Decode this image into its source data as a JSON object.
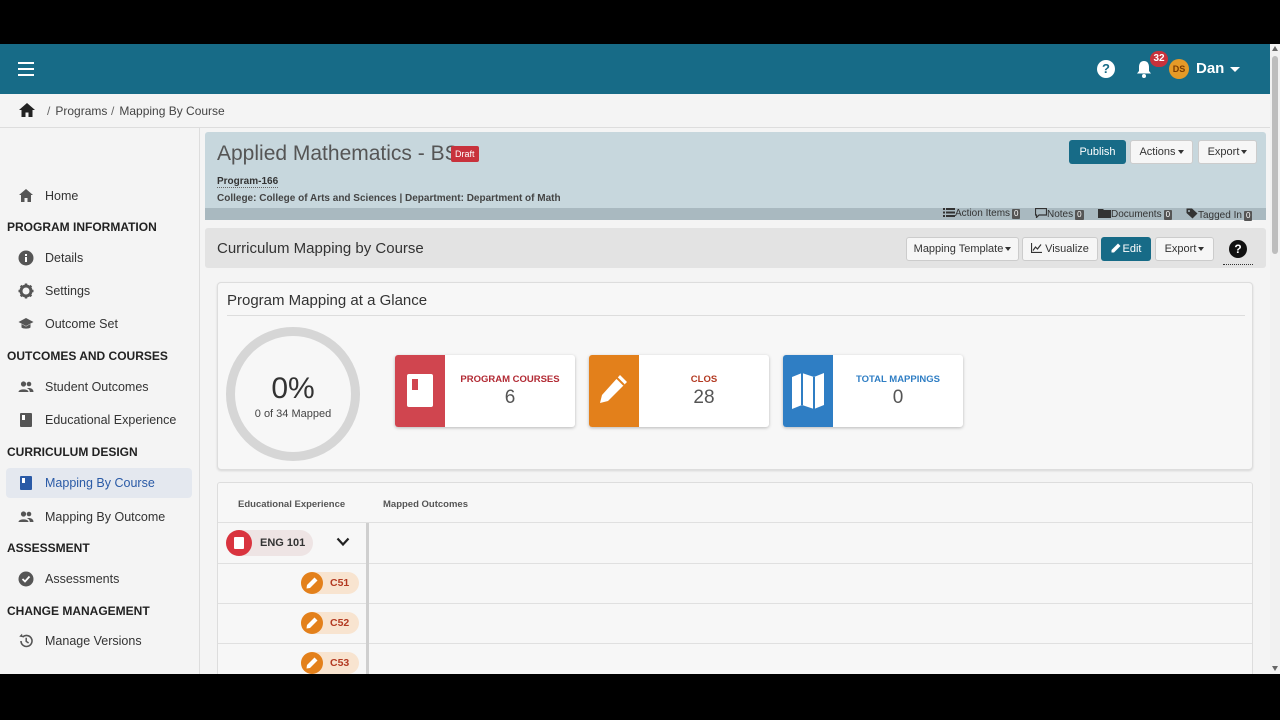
{
  "topbar": {
    "notification_count": "32",
    "avatar_initials": "DS",
    "username": "Dan",
    "help_glyph": "?",
    "icons": [
      "hamburger-menu-icon",
      "help-icon",
      "bell-icon",
      "chevron-down-icon"
    ],
    "color": "#176b87"
  },
  "breadcrumb": {
    "items": [
      "Programs",
      "Mapping By Course"
    ],
    "separator": "/"
  },
  "sidebar": {
    "home": "Home",
    "sections": [
      {
        "heading": "PROGRAM INFORMATION",
        "items": [
          "Details",
          "Settings",
          "Outcome Set"
        ]
      },
      {
        "heading": "OUTCOMES AND COURSES",
        "items": [
          "Student Outcomes",
          "Educational Experience"
        ]
      },
      {
        "heading": "CURRICULUM DESIGN",
        "items": [
          "Mapping By Course",
          "Mapping By Outcome"
        ]
      },
      {
        "heading": "ASSESSMENT",
        "items": [
          "Assessments"
        ]
      },
      {
        "heading": "CHANGE MANAGEMENT",
        "items": [
          "Manage Versions"
        ]
      }
    ],
    "active_item": "Mapping By Course"
  },
  "program": {
    "title": "Applied Mathematics - BS",
    "status_badge": "Draft",
    "id": "Program-166",
    "college_line": "College: College of Arts and Sciences | Department: Department of Math",
    "buttons": {
      "publish": "Publish",
      "actions": "Actions",
      "export": "Export"
    },
    "strip": [
      {
        "label": "Action Items",
        "count": "0"
      },
      {
        "label": "Notes",
        "count": "0"
      },
      {
        "label": "Documents",
        "count": "0"
      },
      {
        "label": "Tagged In",
        "count": "0"
      }
    ]
  },
  "curriculum": {
    "title": "Curriculum Mapping by Course",
    "buttons": {
      "mapping_template": "Mapping Template",
      "visualize": "Visualize",
      "edit": "Edit",
      "export": "Export"
    },
    "help_glyph": "?"
  },
  "glance": {
    "title": "Program Mapping at a Glance",
    "percent": "0%",
    "mapped_text": "0 of 34 Mapped",
    "progress_fraction": 0,
    "stats": [
      {
        "label": "PROGRAM COURSES",
        "value": "6",
        "color": "#d0454f",
        "icon": "book-icon"
      },
      {
        "label": "CLOS",
        "value": "28",
        "color": "#e3801b",
        "icon": "pencil-icon"
      },
      {
        "label": "TOTAL MAPPINGS",
        "value": "0",
        "color": "#2f7ec4",
        "icon": "map-icon"
      }
    ]
  },
  "mapping_table": {
    "headers": [
      "Educational Experience",
      "Mapped Outcomes"
    ],
    "course": "ENG 101",
    "clos": [
      "C51",
      "C52",
      "C53"
    ]
  }
}
